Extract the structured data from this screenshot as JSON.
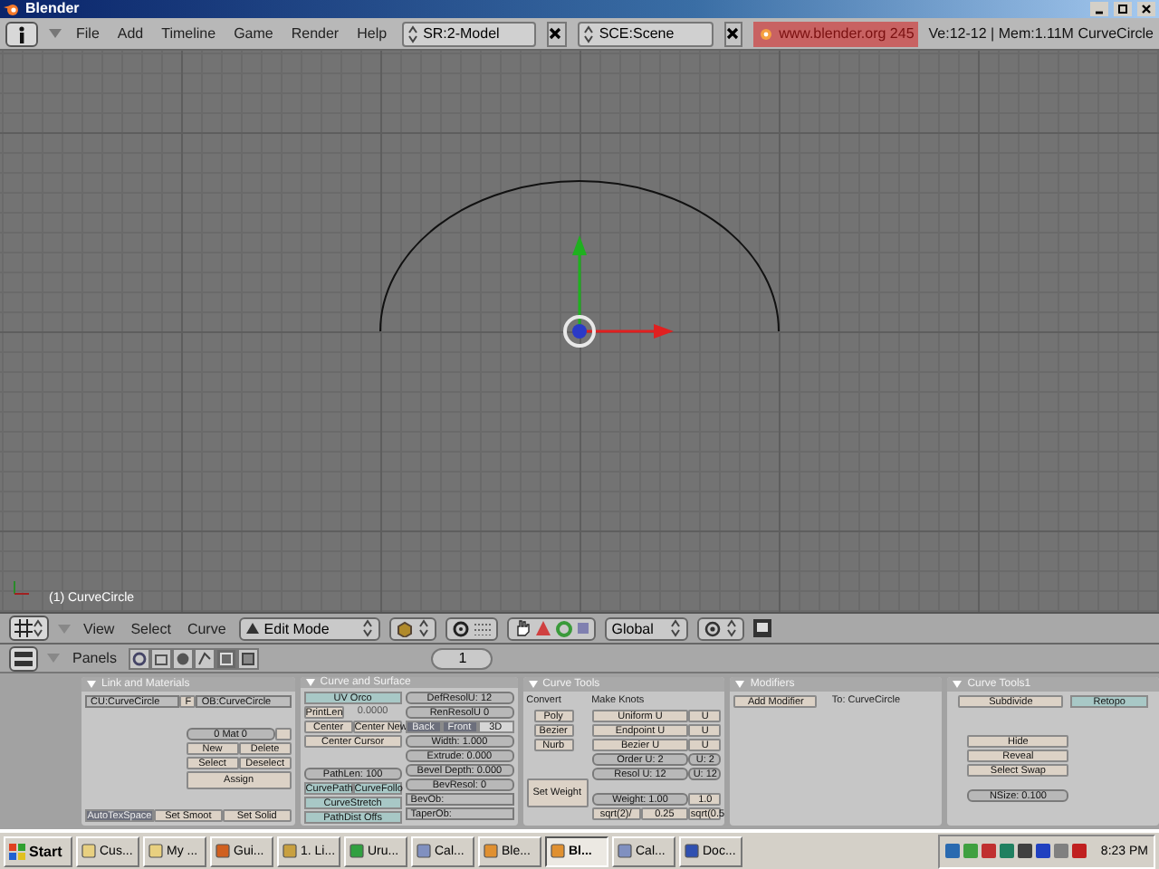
{
  "window": {
    "title": "Blender"
  },
  "info_header": {
    "menus": [
      "File",
      "Add",
      "Timeline",
      "Game",
      "Render",
      "Help"
    ],
    "screen": "SR:2-Model",
    "scene": "SCE:Scene",
    "link": "www.blender.org 245",
    "stats": "Ve:12-12 | Mem:1.11M CurveCircle"
  },
  "viewport": {
    "object_label": "(1) CurveCircle"
  },
  "view_header": {
    "menus": [
      "View",
      "Select",
      "Curve"
    ],
    "mode": "Edit Mode",
    "orientation": "Global"
  },
  "buttons_header": {
    "label": "Panels",
    "tabs": [
      {
        "selected": false
      },
      {
        "selected": false
      },
      {
        "selected": false
      },
      {
        "selected": false
      },
      {
        "selected": true
      },
      {
        "selected": false
      }
    ],
    "frame": "1"
  },
  "panels": [
    {
      "title": "Link and Materials",
      "columns": [
        [
          [
            {
              "kind": "field",
              "label": "CU:CurveCircle"
            },
            {
              "kind": "button",
              "label": "F"
            },
            {
              "kind": "field",
              "label": "OB:CurveCircle"
            }
          ],
          [
            {
              "kind": "num",
              "label": "0 Mat 0"
            },
            {
              "kind": "blank"
            }
          ],
          [
            {
              "kind": "button",
              "label": "New"
            },
            {
              "kind": "button",
              "label": "Delete"
            }
          ],
          [
            {
              "kind": "button",
              "label": "Select"
            },
            {
              "kind": "button",
              "label": "Deselect"
            }
          ],
          [
            {
              "kind": "button",
              "label": "Assign"
            }
          ],
          [
            {
              "kind": "row",
              "label": "AutoTexSpace",
              "on": true
            },
            {
              "kind": "button",
              "label": "Set Smoot"
            },
            {
              "kind": "button",
              "label": "Set Solid"
            }
          ]
        ]
      ]
    },
    {
      "title": "Curve and Surface",
      "columns": [
        [
          [
            {
              "kind": "toggle",
              "label": "UV Orco",
              "on": true
            }
          ],
          [
            {
              "kind": "button",
              "label": "PrintLen"
            },
            {
              "kind": "text",
              "label": "0.0000"
            }
          ],
          [
            {
              "kind": "button",
              "label": "Center"
            },
            {
              "kind": "button",
              "label": "Center New"
            }
          ],
          [
            {
              "kind": "button",
              "label": "Center Cursor"
            }
          ],
          [
            {
              "kind": "num",
              "label": "PathLen: 100"
            }
          ],
          [
            {
              "kind": "toggle",
              "label": "CurvePath",
              "on": true
            },
            {
              "kind": "toggle",
              "label": "CurveFollo",
              "on": true
            }
          ],
          [
            {
              "kind": "toggle",
              "label": "CurveStretch",
              "on": true
            }
          ],
          [
            {
              "kind": "toggle",
              "label": "PathDist Offs",
              "on": true
            }
          ]
        ],
        [
          [
            {
              "kind": "num",
              "label": "DefResolU: 12"
            }
          ],
          [
            {
              "kind": "num",
              "label": "RenResolU 0"
            }
          ],
          [
            {
              "kind": "row",
              "label": "Back",
              "on": true
            },
            {
              "kind": "row",
              "label": "Front",
              "on": true
            },
            {
              "kind": "row",
              "label": "3D",
              "on": false
            }
          ],
          [
            {
              "kind": "num",
              "label": "Width: 1.000"
            }
          ],
          [
            {
              "kind": "num",
              "label": "Extrude: 0.000"
            }
          ],
          [
            {
              "kind": "num",
              "label": "Bevel Depth: 0.000"
            }
          ],
          [
            {
              "kind": "num",
              "label": "BevResol: 0"
            }
          ],
          [
            {
              "kind": "field",
              "label": "BevOb:"
            }
          ],
          [
            {
              "kind": "field",
              "label": "TaperOb:"
            }
          ]
        ]
      ]
    },
    {
      "title": "Curve Tools",
      "columns": [
        [
          [
            {
              "kind": "label",
              "label": "Convert"
            }
          ],
          [
            {
              "kind": "button",
              "label": "Poly"
            }
          ],
          [
            {
              "kind": "button",
              "label": "Bezier"
            }
          ],
          [
            {
              "kind": "button",
              "label": "Nurb"
            }
          ],
          [
            {
              "kind": "big",
              "label": "Set Weight"
            }
          ]
        ],
        [
          [
            {
              "kind": "label",
              "label": "Make Knots"
            }
          ],
          [
            {
              "kind": "button",
              "label": "Uniform U"
            },
            {
              "kind": "button",
              "label": "U"
            }
          ],
          [
            {
              "kind": "button",
              "label": "Endpoint U"
            },
            {
              "kind": "button",
              "label": "U"
            }
          ],
          [
            {
              "kind": "button",
              "label": "Bezier U"
            },
            {
              "kind": "button",
              "label": "U"
            }
          ],
          [
            {
              "kind": "num",
              "label": "Order U: 2"
            },
            {
              "kind": "num",
              "label": "U: 2"
            }
          ],
          [
            {
              "kind": "num",
              "label": "Resol U: 12"
            },
            {
              "kind": "num",
              "label": "U: 12"
            }
          ],
          [
            {
              "kind": "num",
              "label": "Weight: 1.00"
            },
            {
              "kind": "button",
              "label": "1.0"
            }
          ],
          [
            {
              "kind": "button",
              "label": "sqrt(2)/"
            },
            {
              "kind": "button",
              "label": "0.25"
            },
            {
              "kind": "button",
              "label": "sqrt(0.5"
            }
          ]
        ]
      ]
    },
    {
      "title": "Modifiers",
      "columns": [
        [
          [
            {
              "kind": "button",
              "label": "Add Modifier"
            },
            {
              "kind": "label",
              "label": "To: CurveCircle"
            }
          ]
        ]
      ]
    },
    {
      "title": "Curve Tools1",
      "columns": [
        [
          [
            {
              "kind": "button",
              "label": "Subdivide"
            },
            {
              "kind": "toggle",
              "label": "Retopo",
              "on": true
            }
          ],
          [
            {
              "kind": "button",
              "label": "Hide"
            }
          ],
          [
            {
              "kind": "button",
              "label": "Reveal"
            }
          ],
          [
            {
              "kind": "button",
              "label": "Select Swap"
            }
          ],
          [
            {
              "kind": "num",
              "label": "NSize: 0.100"
            }
          ]
        ]
      ]
    }
  ],
  "taskbar": {
    "start": "Start",
    "tasks": [
      {
        "label": "Cus...",
        "selected": false
      },
      {
        "label": "My ...",
        "selected": false
      },
      {
        "label": "Gui...",
        "selected": false
      },
      {
        "label": "1. Li...",
        "selected": false
      },
      {
        "label": "Uru...",
        "selected": false
      },
      {
        "label": "Cal...",
        "selected": false
      },
      {
        "label": "Ble...",
        "selected": false
      },
      {
        "label": "Bl...",
        "selected": true
      },
      {
        "label": "Cal...",
        "selected": false
      },
      {
        "label": "Doc...",
        "selected": false
      }
    ],
    "clock": "8:23 PM"
  }
}
